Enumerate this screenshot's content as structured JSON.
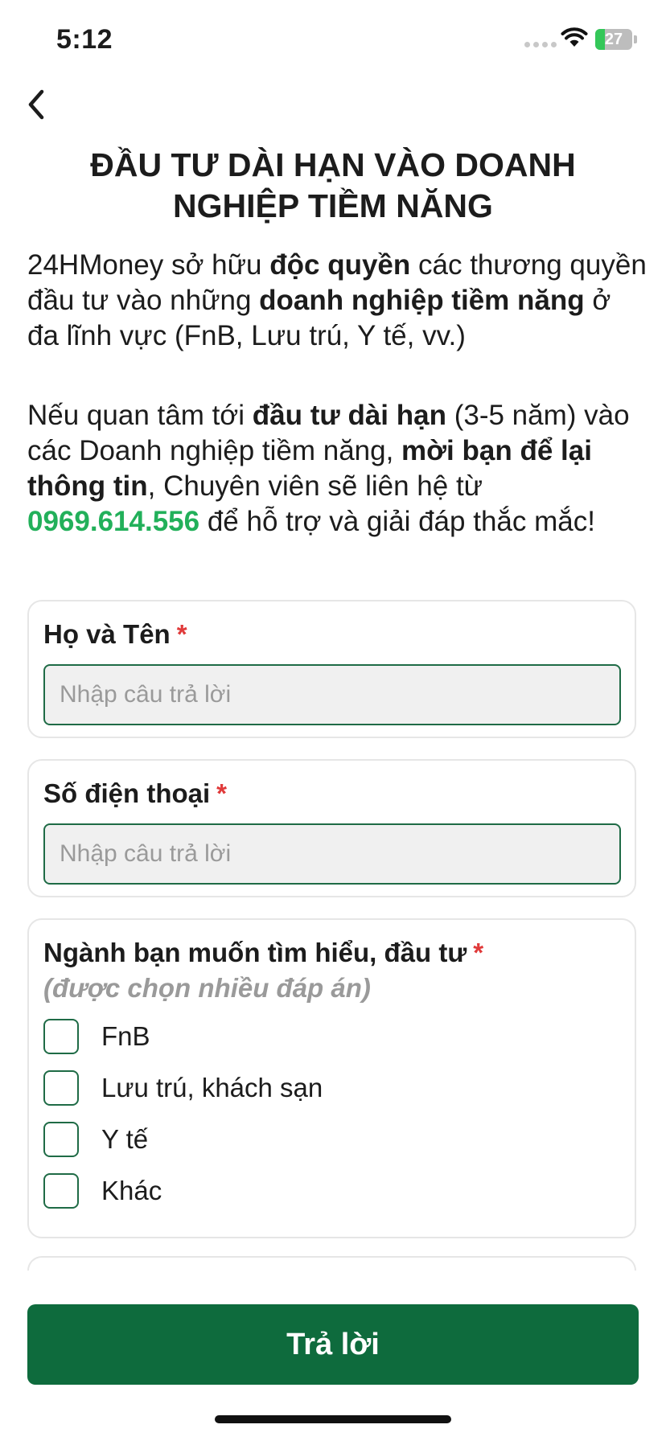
{
  "status_bar": {
    "time": "5:12",
    "battery": "27"
  },
  "title": "ĐẦU TƯ DÀI HẠN VÀO DOANH NGHIỆP TIỀM NĂNG",
  "intro1": {
    "t1": "24HMoney sở hữu ",
    "b1": "độc quyền",
    "t2": " các thương quyền đầu tư vào những ",
    "b2": "doanh nghiệp tiềm năng",
    "t3": " ở đa lĩnh vực (FnB, Lưu trú, Y tế, vv.)"
  },
  "intro2": {
    "t1": "Nếu quan tâm tới ",
    "b1": "đầu tư dài hạn",
    "t2": " (3-5 năm) vào các Doanh nghiệp tiềm năng, ",
    "b2": "mời bạn để lại thông tin",
    "t3": ", Chuyên viên sẽ liên hệ từ ",
    "phone": "0969.614.556",
    "t4": " để hỗ trợ và giải đáp thắc mắc!"
  },
  "form": {
    "name": {
      "label": "Họ và Tên",
      "required": "*",
      "placeholder": "Nhập câu trả lời",
      "value": ""
    },
    "phone": {
      "label": "Số điện thoại",
      "required": "*",
      "placeholder": "Nhập câu trả lời",
      "value": ""
    },
    "industry": {
      "label": "Ngành bạn muốn tìm hiểu, đầu tư",
      "required": "*",
      "hint": "(được chọn nhiều đáp án)",
      "options": [
        {
          "label": "FnB",
          "checked": false
        },
        {
          "label": "Lưu trú, khách sạn",
          "checked": false
        },
        {
          "label": "Y tế",
          "checked": false
        },
        {
          "label": "Khác",
          "checked": false
        }
      ]
    }
  },
  "submit_label": "Trả lời",
  "colors": {
    "primary": "#0e6b3d",
    "accent_green": "#22b05a",
    "required_red": "#e03a3a",
    "battery_green": "#34c759"
  },
  "icons": {
    "back": "chevron-left-icon",
    "wifi": "wifi-icon",
    "signal": "signal-icon",
    "battery": "battery-icon"
  }
}
